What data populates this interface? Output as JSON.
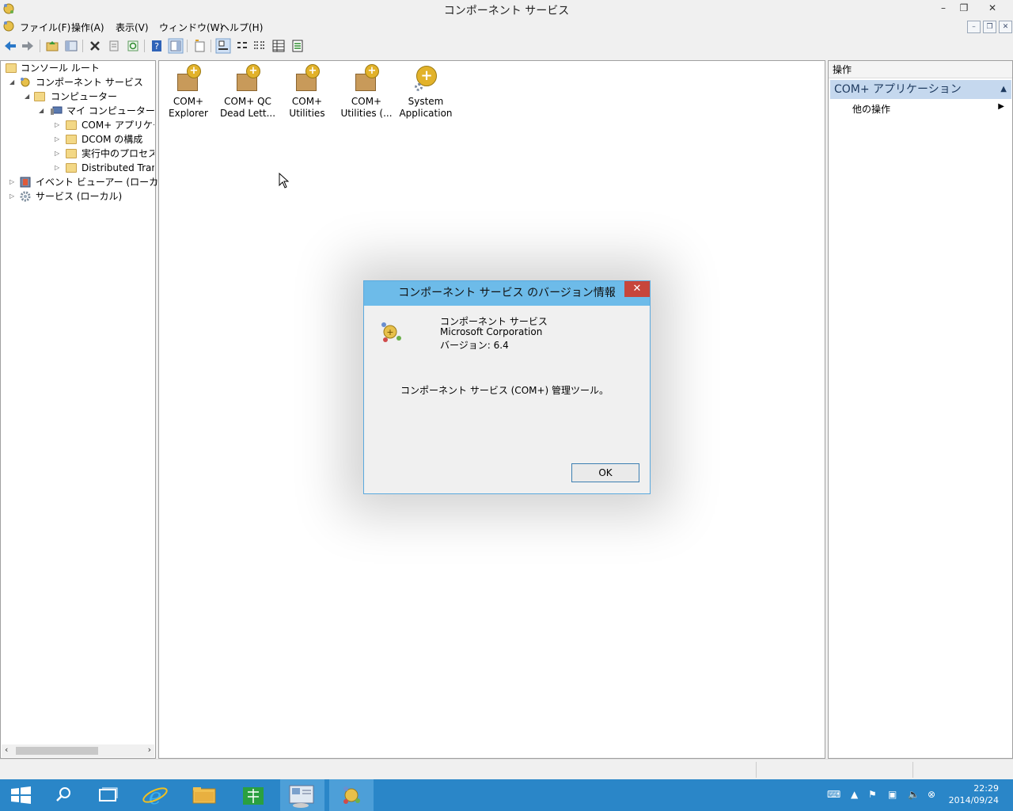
{
  "window": {
    "title": "コンポーネント サービス",
    "minimize": "–",
    "restore": "❐",
    "close": "✕"
  },
  "menu": [
    "ファイル(F)",
    "操作(A)",
    "表示(V)",
    "ウィンドウ(W)",
    "ヘルプ(H)"
  ],
  "mdi_controls": {
    "minimize": "–",
    "restore": "❐",
    "close": "✕"
  },
  "tree": {
    "nodes": [
      {
        "label": "コンソール ルート"
      },
      {
        "label": "コンポーネント サービス"
      },
      {
        "label": "コンピューター"
      },
      {
        "label": "マイ コンピューター"
      },
      {
        "label": "COM+ アプリケーション"
      },
      {
        "label": "DCOM の構成"
      },
      {
        "label": "実行中のプロセス"
      },
      {
        "label": "Distributed Transaction Coordinator"
      },
      {
        "label": "イベント ビューアー (ローカル)"
      },
      {
        "label": "サービス (ローカル)"
      }
    ]
  },
  "content": {
    "items": [
      {
        "line1": "COM+",
        "line2": "Explorer"
      },
      {
        "line1": "COM+ QC",
        "line2": "Dead Lett..."
      },
      {
        "line1": "COM+",
        "line2": "Utilities"
      },
      {
        "line1": "COM+",
        "line2": "Utilities (..."
      },
      {
        "line1": "System",
        "line2": "Application"
      }
    ]
  },
  "actions": {
    "header": "操作",
    "selected": "COM+ アプリケーション",
    "more": "他の操作"
  },
  "dialog": {
    "title": "コンポーネント サービス のバージョン情報",
    "close": "✕",
    "product": "コンポーネント サービス",
    "company": "Microsoft Corporation",
    "version": "バージョン: 6.4",
    "description": "コンポーネント サービス (COM+) 管理ツール。",
    "ok": "OK"
  },
  "taskbar": {
    "time": "22:29",
    "date": "2014/09/24"
  },
  "colors": {
    "taskbar": "#2a86c8",
    "dialog_title": "#6dbbe9",
    "close_red": "#c7453b",
    "selection": "#c5d8ee"
  }
}
